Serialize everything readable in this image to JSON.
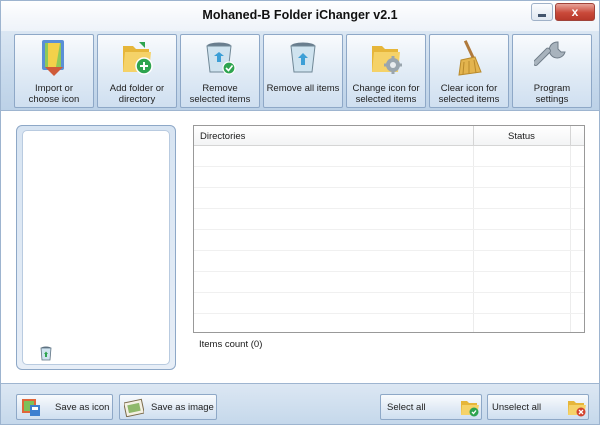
{
  "window": {
    "title": "Mohaned-B Folder iChanger v2.1",
    "close_glyph": "x"
  },
  "toolbar": {
    "buttons": [
      {
        "label": "Import or\nchoose icon",
        "icon": "pencil-palette-icon"
      },
      {
        "label": "Add folder or\ndirectory",
        "icon": "folder-add-icon"
      },
      {
        "label": "Remove\nselected items",
        "icon": "recycle-bin-check-icon"
      },
      {
        "label": "Remove all items",
        "icon": "recycle-bin-icon"
      },
      {
        "label": "Change icon for\nselected items",
        "icon": "folder-gear-icon"
      },
      {
        "label": "Clear icon for\nselected items",
        "icon": "broom-icon"
      },
      {
        "label": "Program\nsettings",
        "icon": "wrench-icon"
      }
    ]
  },
  "table": {
    "headers": {
      "directories": "Directories",
      "status": "Status"
    },
    "rows": [
      {
        "directory": "",
        "status": ""
      },
      {
        "directory": "",
        "status": ""
      },
      {
        "directory": "",
        "status": ""
      },
      {
        "directory": "",
        "status": ""
      },
      {
        "directory": "",
        "status": ""
      },
      {
        "directory": "",
        "status": ""
      },
      {
        "directory": "",
        "status": ""
      },
      {
        "directory": "",
        "status": ""
      },
      {
        "directory": "",
        "status": ""
      }
    ]
  },
  "status": {
    "items_count": "Items count (0)"
  },
  "bottom": {
    "save_as_icon": "Save as icon",
    "save_as_image": "Save as image",
    "select_all": "Select all",
    "unselect_all": "Unselect all"
  },
  "colors": {
    "toolbar_bg": "#c8daec",
    "button_border": "#8ea8c7",
    "close_button": "#c9493a",
    "folder": "#f0c94a",
    "bin": "#8ccde6",
    "accent_green": "#2ea44f"
  }
}
